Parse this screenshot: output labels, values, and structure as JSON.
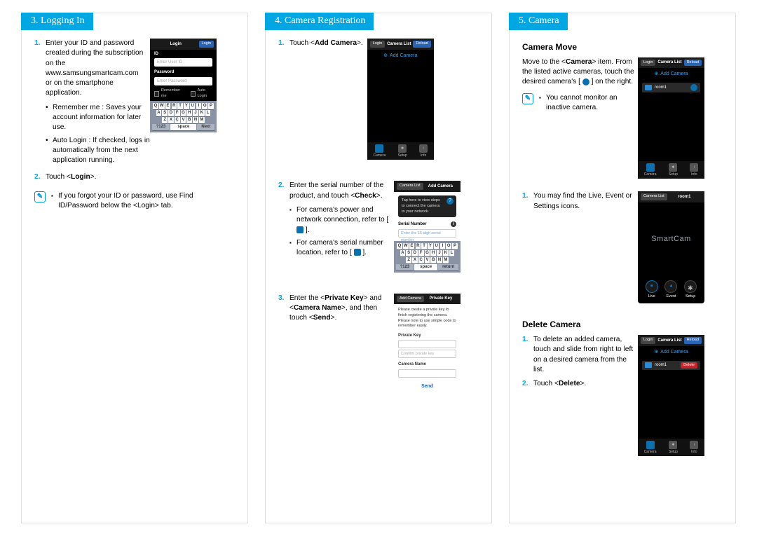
{
  "columns": [
    {
      "heading": "3. Logging In",
      "steps": [
        {
          "num": "1.",
          "text": "Enter your ID and password created during the subscription on the www.samsungsmartcam.com or on the smartphone application.",
          "bullets": [
            "Remember me : Saves your account information for later use.",
            "Auto Login : If checked, logs in automatically from the next application running."
          ]
        },
        {
          "num": "2.",
          "text_html": "Touch <<b>Login</b>>."
        }
      ],
      "note": "If you forgot your ID or password, use Find ID/Password below the <Login> tab.",
      "phone_login": {
        "title": "Login",
        "btn": "Login",
        "id_label": "ID",
        "id_ph": "Enter User ID",
        "pw_label": "Password",
        "pw_ph": "Enter Password",
        "remember": "Remember me",
        "auto": "Auto Login",
        "kb_bottom": [
          "?123",
          "space",
          "Next"
        ]
      }
    },
    {
      "heading": "4. Camera Registration",
      "steps": [
        {
          "num": "1.",
          "text_html": "Touch <<b>Add Camera</b>>.",
          "phone": "cameralist"
        },
        {
          "num": "2.",
          "text_html": "Enter the serial number of the product, and touch <<b>Check</b>>.",
          "sq_bullets": [
            "For camera's power and network connection, refer to [ ⬚ ].",
            "For camera's serial number location, refer to [ ⬚ ]."
          ],
          "phone": "addcamera"
        },
        {
          "num": "3.",
          "text_html": "Enter the <<b>Private Key</b>> and <<b>Camera Name</b>>, and then touch <<b>Send</b>>.",
          "phone": "privatekey"
        }
      ],
      "phone_cameralist": {
        "title": "Camera List",
        "left": "Login",
        "right": "Reload",
        "add": "Add Camera",
        "tools": [
          "Camera",
          "Setup",
          "Info"
        ]
      },
      "phone_addcamera": {
        "title": "Add Camera",
        "left": "Camera List",
        "tip": "Tap here to view steps to connect the camera to your network.",
        "sn": "Serial Number",
        "sn_ph": "Enter the 15-digit serial number",
        "kb_bottom": [
          "?123",
          "space",
          "return"
        ]
      },
      "phone_privatekey": {
        "title": "Private Key",
        "left": "Add Camera",
        "desc": "Please create a private key to finish registering the camera. Please note to use simple code to remember easily.",
        "lbl1": "Private Key",
        "lbl1_ph": "",
        "lbl2_ph": "Confirm private key",
        "lbl3": "Camera Name",
        "send": "Send"
      }
    },
    {
      "heading": "5. Camera",
      "sections": [
        {
          "title": "Camera Move",
          "para_html": "Move to the <<b>Camera</b>> item. From the listed active cameras, touch the desired camera's [ <span class='inline-ic round'></span> ] on the right.",
          "note": "You cannot monitor an inactive camera.",
          "phone": "cml_room"
        },
        {
          "steps": [
            {
              "num": "1.",
              "text": "You may find the Live, Event or Settings icons."
            }
          ],
          "phone": "smartcam"
        },
        {
          "title": "Delete Camera",
          "steps": [
            {
              "num": "1.",
              "text": "To delete an added camera, touch and slide from right to left on a desired camera from the list."
            },
            {
              "num": "2.",
              "text_html": "Touch <<b>Delete</b>>."
            }
          ],
          "phone": "cml_delete"
        }
      ],
      "phone_cml": {
        "title": "Camera List",
        "left": "Login",
        "right": "Reload",
        "add": "Add Camera",
        "item": "room1",
        "tools": [
          "Camera",
          "Setup",
          "Info"
        ]
      },
      "phone_smartcam": {
        "title": "room1",
        "left": "Camera List",
        "logo": "SmartCam",
        "btns": [
          "Live",
          "Event",
          "Setup"
        ]
      },
      "phone_delete": {
        "title": "Camera List",
        "left": "Login",
        "right": "Reload",
        "add": "Add Camera",
        "item": "room1",
        "del": "Delete",
        "tools": [
          "Camera",
          "Setup",
          "Info"
        ]
      }
    }
  ],
  "kb_rows": [
    [
      "Q",
      "W",
      "E",
      "R",
      "T",
      "Y",
      "U",
      "I",
      "O",
      "P"
    ],
    [
      "A",
      "S",
      "D",
      "F",
      "G",
      "H",
      "J",
      "K",
      "L"
    ],
    [
      "Z",
      "X",
      "C",
      "V",
      "B",
      "N",
      "M"
    ]
  ]
}
